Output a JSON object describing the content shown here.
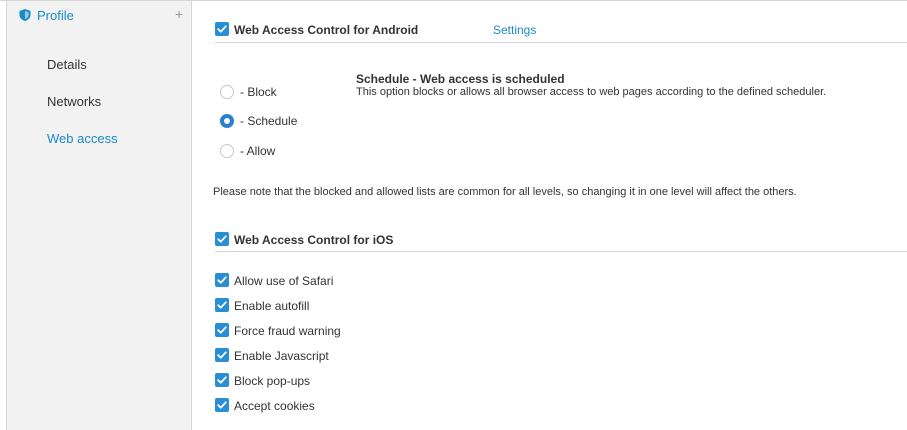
{
  "sidebar": {
    "title": "Profile",
    "add_symbol": "+",
    "items": [
      {
        "label": "Details"
      },
      {
        "label": "Networks"
      },
      {
        "label": "Web access"
      }
    ]
  },
  "android": {
    "title": "Web Access Control for Android",
    "checked": true,
    "settings_link": "Settings",
    "options": [
      {
        "label": "- Block",
        "selected": false
      },
      {
        "label": "- Schedule",
        "selected": true
      },
      {
        "label": "- Allow",
        "selected": false
      }
    ],
    "schedule_title": "Schedule - Web access is scheduled",
    "schedule_description": "This option blocks or allows all browser access to web pages according to the defined scheduler."
  },
  "note": "Please note that the blocked and allowed lists are common for all levels, so changing it in one level will affect the others.",
  "ios": {
    "title": "Web Access Control for iOS",
    "checked": true,
    "options": [
      {
        "label": "Allow use of Safari",
        "checked": true
      },
      {
        "label": "Enable autofill",
        "checked": true
      },
      {
        "label": "Force fraud warning",
        "checked": true
      },
      {
        "label": "Enable Javascript",
        "checked": true
      },
      {
        "label": "Block pop-ups",
        "checked": true
      },
      {
        "label": "Accept cookies",
        "checked": true
      }
    ]
  },
  "colors": {
    "accent": "#2a8ed4",
    "link": "#1a8ac9",
    "sidebar_bg": "#f2f2f2"
  }
}
